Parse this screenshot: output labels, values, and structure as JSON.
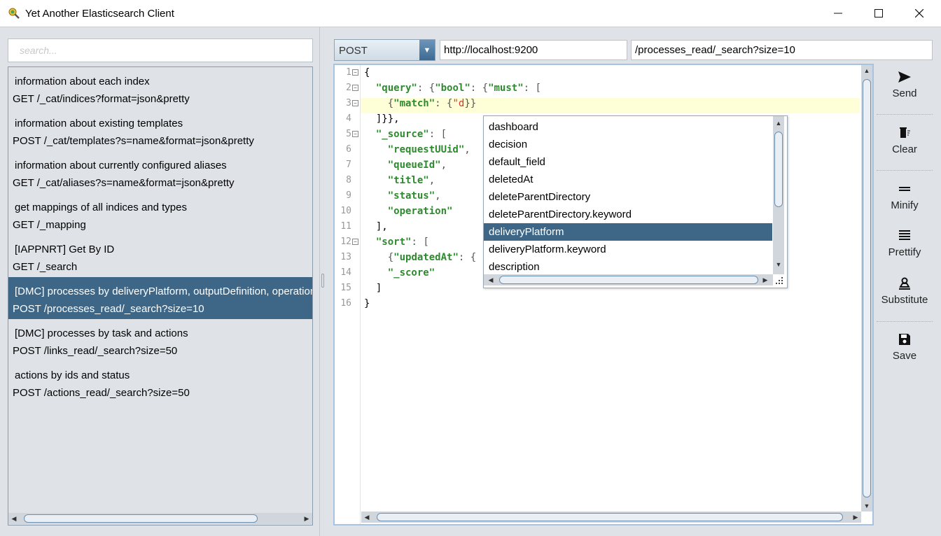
{
  "window": {
    "title": "Yet Another Elasticsearch Client",
    "controls": {
      "minimize": "—",
      "maximize": "☐",
      "close": "✕"
    }
  },
  "sidebar": {
    "search_placeholder": "search...",
    "items": [
      {
        "description": "information about each index",
        "request": "GET /_cat/indices?format=json&pretty"
      },
      {
        "description": "information about existing templates",
        "request": "POST /_cat/templates?s=name&format=json&pretty"
      },
      {
        "description": "information about currently configured aliases",
        "request": "GET /_cat/aliases?s=name&format=json&pretty"
      },
      {
        "description": "get mappings of all indices and types",
        "request": "GET /_mapping"
      },
      {
        "description": "[IAPPNRT] Get By ID",
        "request": "GET /_search"
      },
      {
        "description": "[DMC] processes by deliveryPlatform, outputDefinition, operation and ...",
        "request": "POST /processes_read/_search?size=10"
      },
      {
        "description": "[DMC] processes by task and actions",
        "request": "POST /links_read/_search?size=50"
      },
      {
        "description": "actions by ids and status",
        "request": "POST /actions_read/_search?size=50"
      }
    ],
    "selected_index": 5
  },
  "request": {
    "method": "POST",
    "host": "http://localhost:9200",
    "path": "/processes_read/_search?size=10"
  },
  "editor": {
    "line_numbers": [
      "1",
      "2",
      "3",
      "4",
      "5",
      "6",
      "7",
      "8",
      "9",
      "10",
      "11",
      "12",
      "13",
      "14",
      "15",
      "16"
    ],
    "lines": [
      "{",
      "  \"query\": {\"bool\": {\"must\": [",
      "    {\"match\": {\"d}}",
      "  ]}},",
      "  \"_source\": [",
      "    \"requestUUid\",",
      "    \"queueId\",",
      "    \"title\",",
      "    \"status\",",
      "    \"operation\"",
      "  ],",
      "  \"sort\": [",
      "    {\"updatedAt\": {",
      "    \"_score\"",
      "  ]",
      "}"
    ]
  },
  "autocomplete": {
    "items": [
      "dashboard",
      "decision",
      "default_field",
      "deletedAt",
      "deleteParentDirectory",
      "deleteParentDirectory.keyword",
      "deliveryPlatform",
      "deliveryPlatform.keyword",
      "description"
    ],
    "selected_index": 6
  },
  "toolbar": {
    "send": "Send",
    "clear": "Clear",
    "minify": "Minify",
    "prettify": "Prettify",
    "substitute": "Substitute",
    "save": "Save"
  },
  "colors": {
    "selection": "#3d6687",
    "panel_bg": "#dfe3e8",
    "current_line": "#ffffd7",
    "json_key": "#2e8a2e",
    "json_string": "#d23a2a"
  }
}
